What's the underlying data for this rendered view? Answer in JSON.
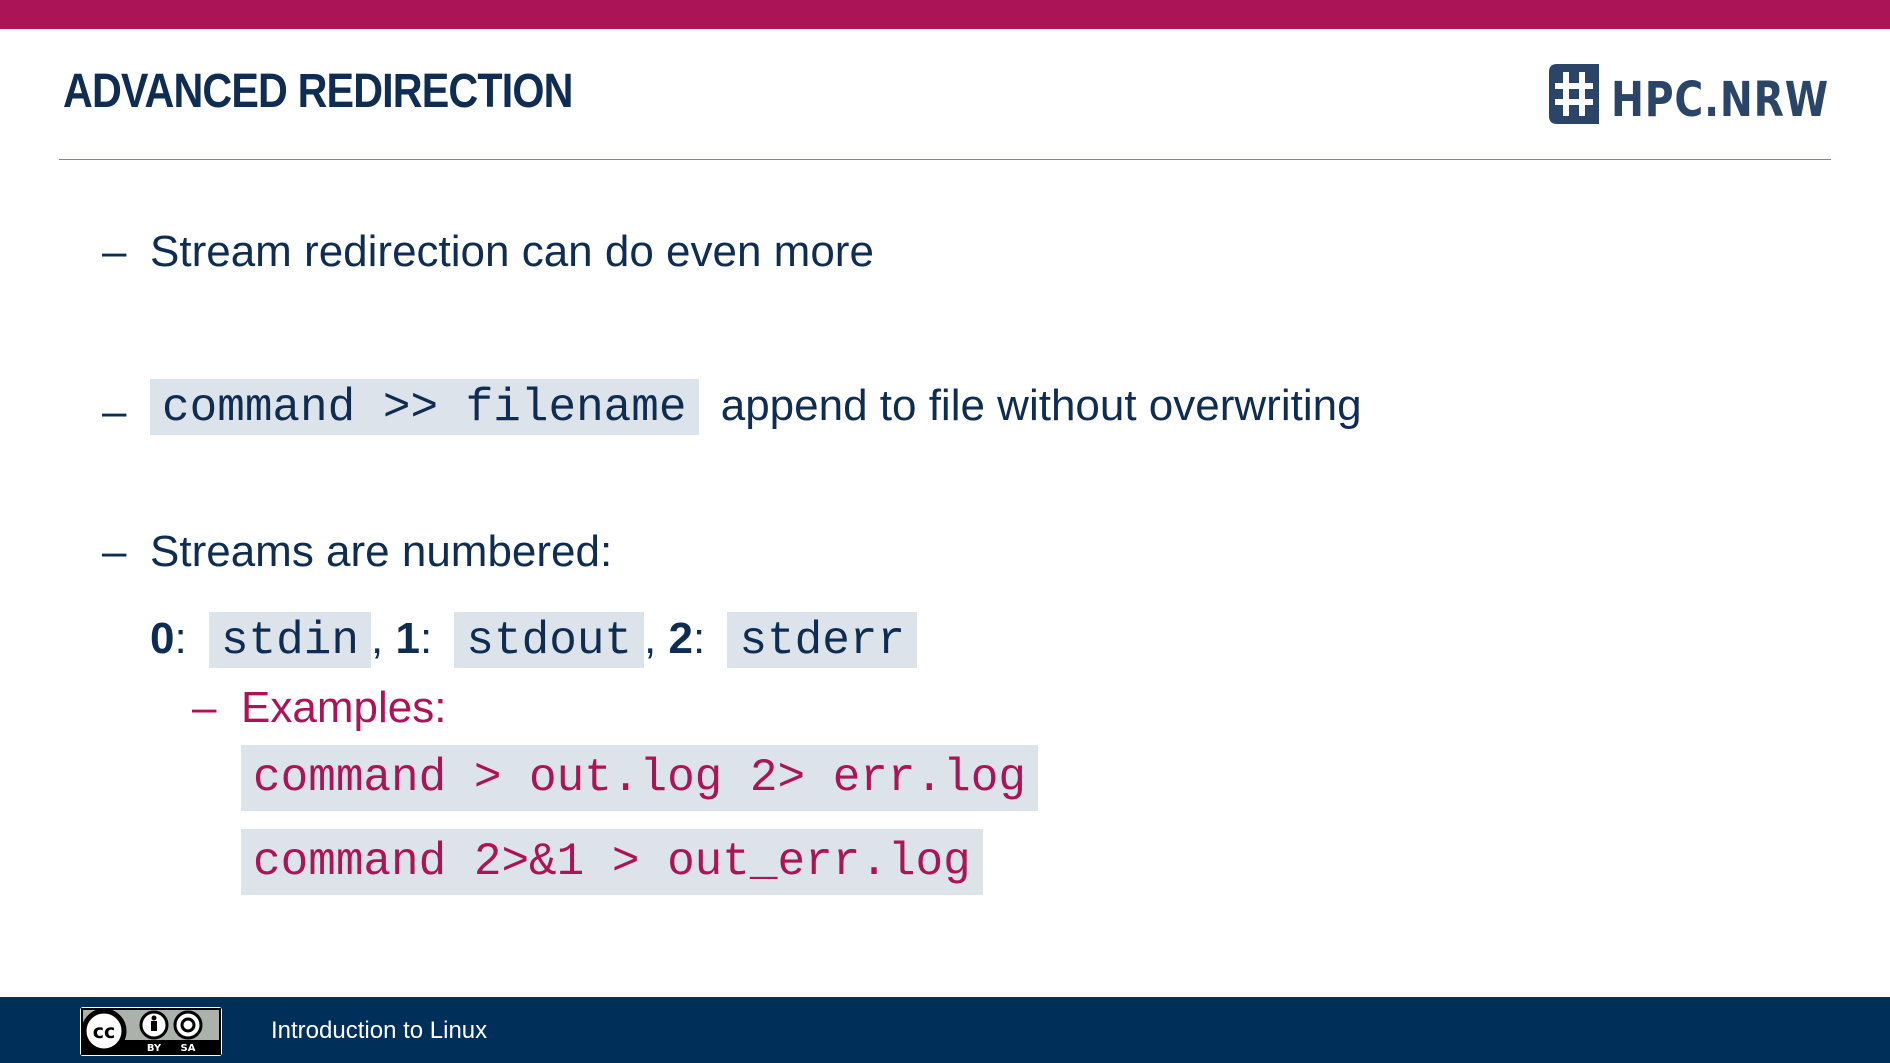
{
  "slide": {
    "title": "ADVANCED REDIRECTION",
    "logo_text": "HPC.NRW",
    "dash": "–",
    "bullets": {
      "b1": "Stream redirection can do even more",
      "b2_code": "command >> filename",
      "b2_text": "append to file without overwriting",
      "b3": "Streams are numbered:"
    },
    "streams": {
      "n0": "0",
      "s0": "stdin",
      "n1": "1",
      "s1": "stdout",
      "n2": "2",
      "s2": "stderr",
      "colon": ":",
      "comma": ","
    },
    "examples": {
      "label": "Examples:",
      "ex1": "command > out.log 2> err.log",
      "ex2": "command 2>&1 > out_err.log"
    }
  },
  "footer": {
    "text": "Introduction to Linux",
    "license_by": "BY",
    "license_sa": "SA"
  },
  "colors": {
    "accent": "#ab1558",
    "navy": "#0f2d52",
    "footer_bg": "#00305a",
    "code_bg": "#dde3ea"
  }
}
